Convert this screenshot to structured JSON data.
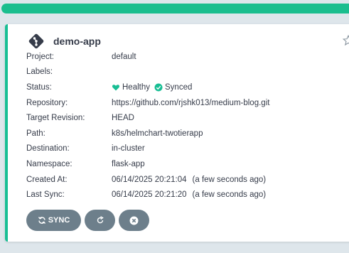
{
  "app": {
    "name": "demo-app",
    "fields": [
      {
        "label": "Project:",
        "value": "default"
      },
      {
        "label": "Labels:",
        "value": ""
      },
      {
        "label": "Status:",
        "value": ""
      },
      {
        "label": "Repository:",
        "value": "https://github.com/rjshk013/medium-blog.git"
      },
      {
        "label": "Target Revision:",
        "value": "HEAD"
      },
      {
        "label": "Path:",
        "value": "k8s/helmchart-twotierapp"
      },
      {
        "label": "Destination:",
        "value": "in-cluster"
      },
      {
        "label": "Namespace:",
        "value": "flask-app"
      },
      {
        "label": "Created At:",
        "value": "06/14/2025 20:21:04",
        "ago": "(a few seconds ago)"
      },
      {
        "label": "Last Sync:",
        "value": "06/14/2025 20:21:20",
        "ago": "(a few seconds ago)"
      }
    ],
    "status": {
      "health": "Healthy",
      "sync": "Synced",
      "health_icon": "heart-icon",
      "sync_icon": "check-circle-icon"
    }
  },
  "actions": {
    "sync_label": "SYNC",
    "sync_icon": "sync-icon",
    "refresh_icon": "refresh-icon",
    "delete_icon": "delete-icon"
  },
  "colors": {
    "accent": "#18be94",
    "button": "#6d7f8b",
    "text": "#363c4a",
    "background": "#dee6eb"
  }
}
